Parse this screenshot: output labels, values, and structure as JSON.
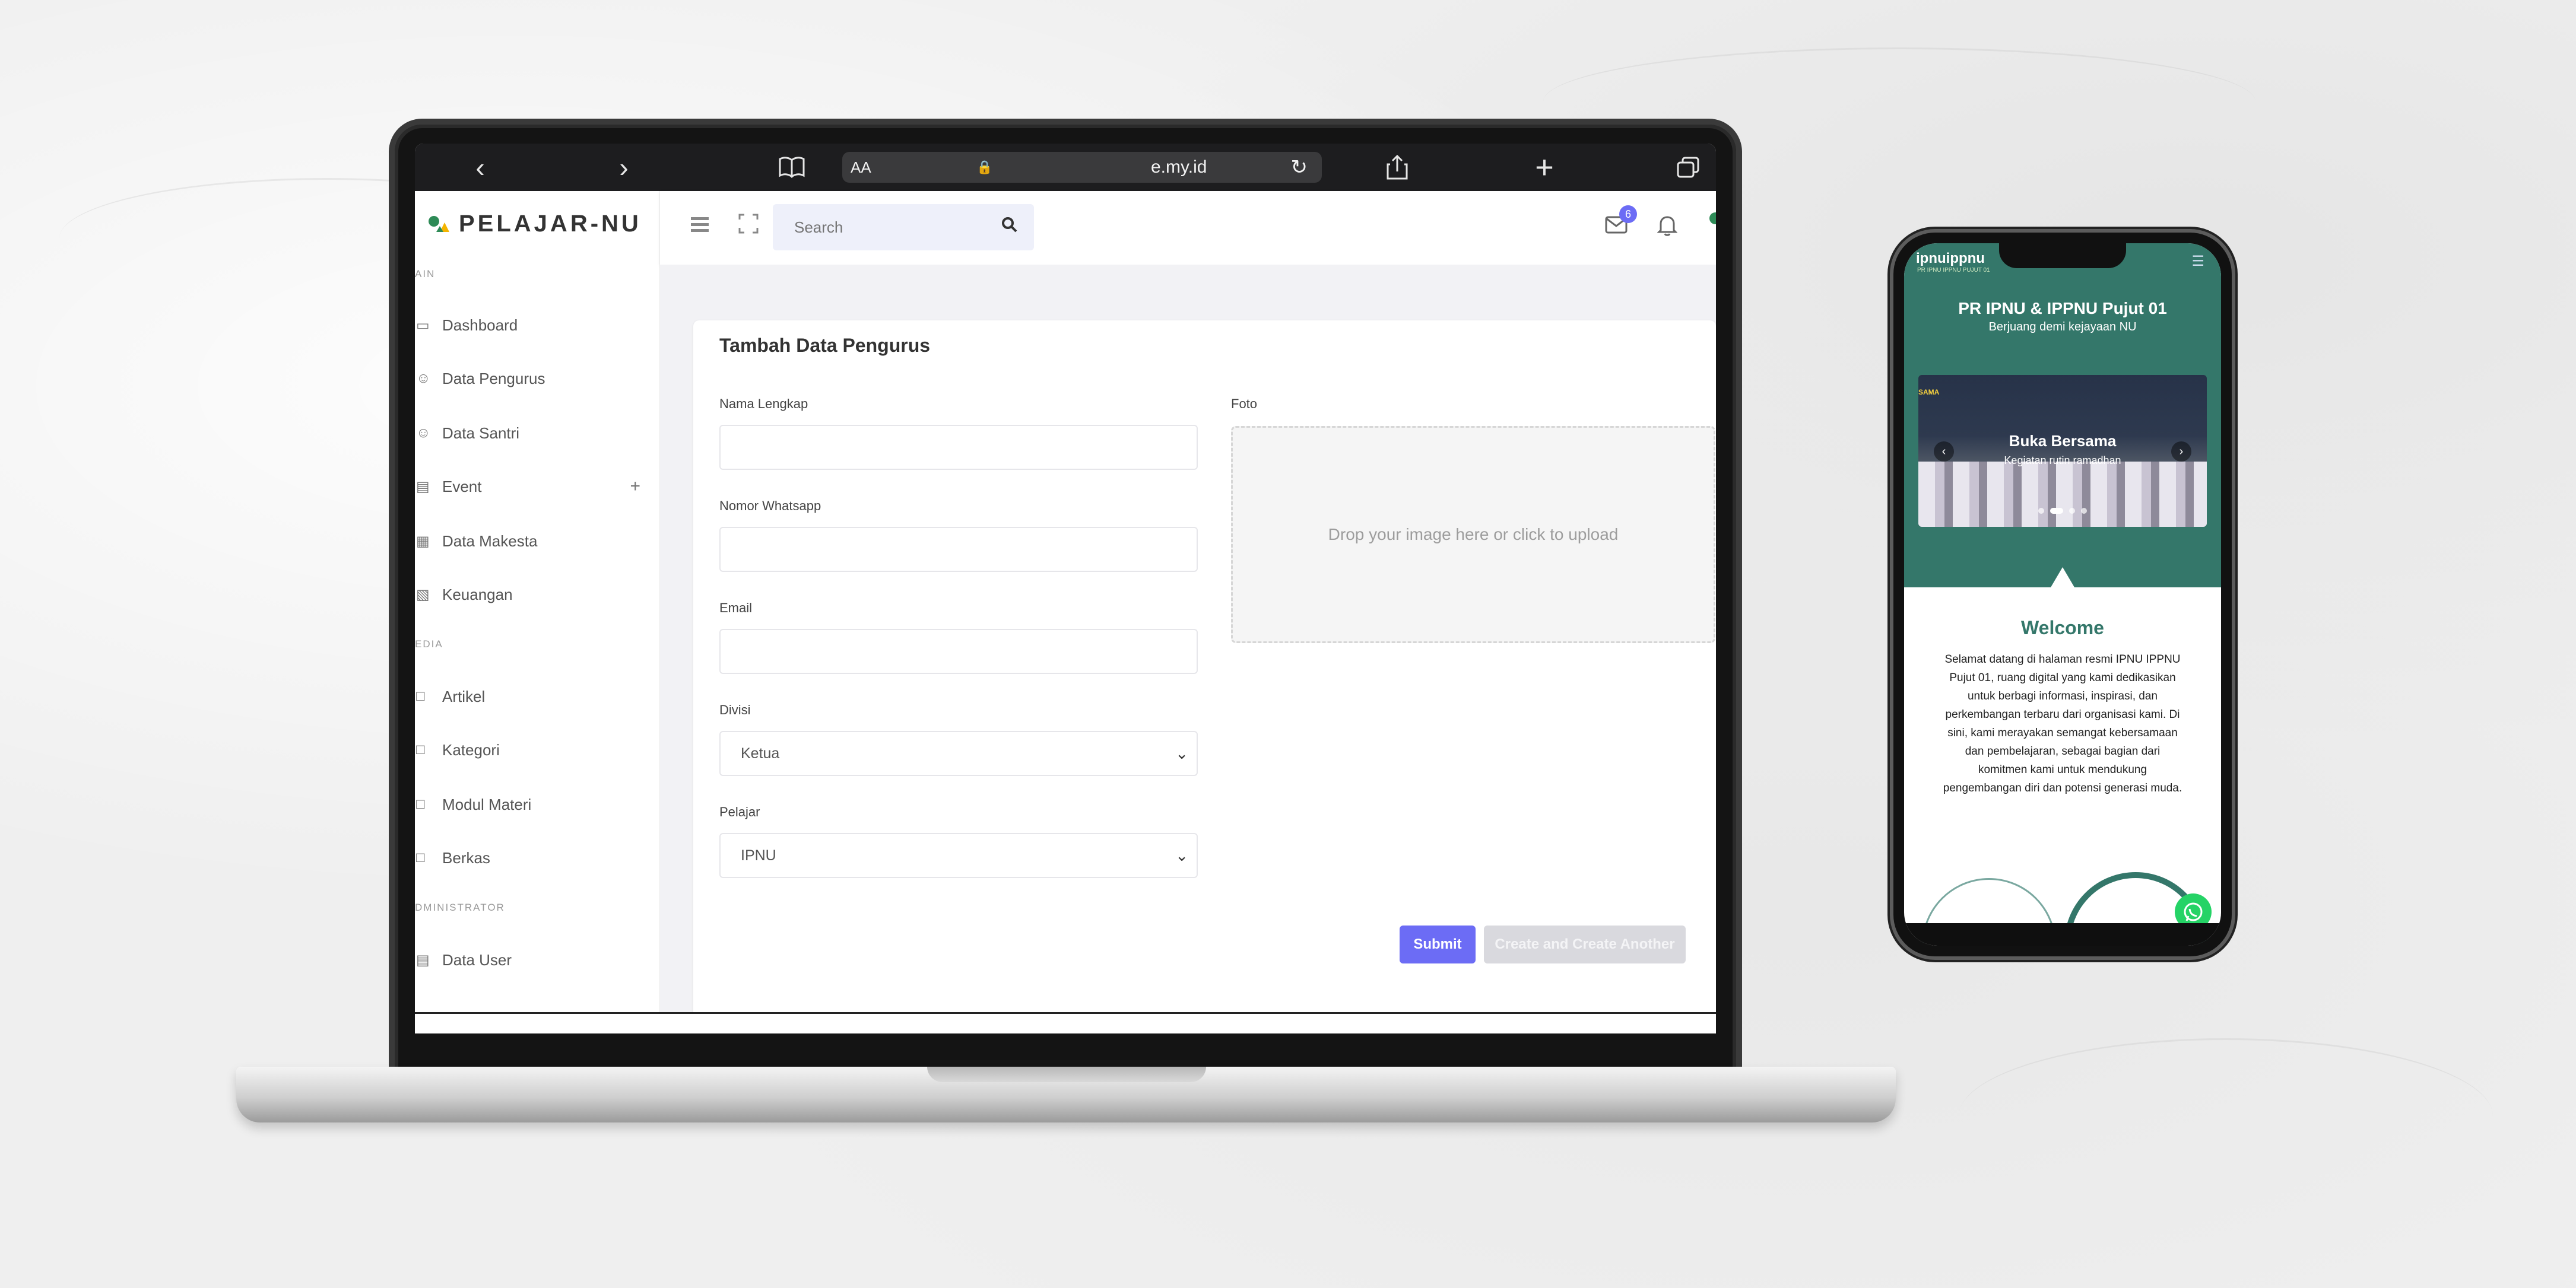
{
  "laptop": {
    "browser": {
      "reader_label": "AA",
      "url_text": "e.my.id"
    },
    "app": {
      "brand": "PELAJAR-NU",
      "sidebar": {
        "heading_main": "AIN",
        "items_main": [
          {
            "label": "Dashboard",
            "icon": "monitor-icon"
          },
          {
            "label": "Data Pengurus",
            "icon": "users-icon"
          },
          {
            "label": "Data Santri",
            "icon": "users-icon"
          },
          {
            "label": "Event",
            "icon": "calendar-icon"
          },
          {
            "label": "Data Makesta",
            "icon": "sitemap-icon"
          },
          {
            "label": "Keuangan",
            "icon": "calculator-icon"
          }
        ],
        "heading_media": "EDIA",
        "items_media": [
          {
            "label": "Artikel",
            "icon": "folder-icon"
          },
          {
            "label": "Kategori",
            "icon": "bookmark-icon"
          },
          {
            "label": "Modul Materi",
            "icon": "book-icon"
          },
          {
            "label": "Berkas",
            "icon": "folder-icon"
          }
        ],
        "heading_admin": "DMINISTRATOR",
        "items_admin": [
          {
            "label": "Data User",
            "icon": "server-icon"
          }
        ],
        "event_expand": "+"
      },
      "topnav": {
        "search_placeholder": "Search",
        "mail_badge": "6"
      },
      "form": {
        "title": "Tambah Data Pengurus",
        "nama_label": "Nama Lengkap",
        "nomor_label": "Nomor Whatsapp",
        "email_label": "Email",
        "divisi_label": "Divisi",
        "divisi_value": "Ketua",
        "pelajar_label": "Pelajar",
        "pelajar_value": "IPNU",
        "foto_label": "Foto",
        "dropzone_text": "Drop your image here or click to upload",
        "submit_label": "Submit",
        "create_another_label": "Create and Create Another"
      },
      "colors": {
        "primary": "#6c6cf5",
        "muted_button": "#d9d9de"
      }
    }
  },
  "phone": {
    "logo": "ipnuippnu",
    "logo_sub": "PR IPNU IPPNU PUJUT 01",
    "hero_title": "PR IPNU & IPPNU Pujut 01",
    "hero_subtitle": "Berjuang demi kejayaan NU",
    "carousel": {
      "caption_title": "Buka Bersama",
      "caption_sub": "Kegiatan rutin ramadhan",
      "tag": "SAMA"
    },
    "welcome_title": "Welcome",
    "welcome_text": "Selamat datang di halaman resmi IPNU IPPNU Pujut 01, ruang digital yang kami dedikasikan untuk berbagi informasi, inspirasi, dan perkembangan terbaru dari organisasi kami. Di sini, kami merayakan semangat kebersamaan dan pembelajaran, sebagai bagian dari komitmen kami untuk mendukung pengembangan diri dan potensi generasi muda.",
    "colors": {
      "teal": "#34776a",
      "whatsapp": "#25d366"
    }
  }
}
